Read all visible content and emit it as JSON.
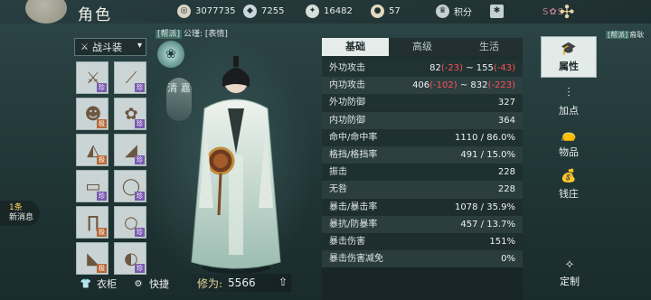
{
  "header": {
    "title": "角色",
    "currencies": [
      {
        "icon": "coin-icon",
        "value": "3077735"
      },
      {
        "icon": "ingot-icon",
        "value": "7255"
      },
      {
        "icon": "jade-icon",
        "value": "16482"
      },
      {
        "icon": "pouch-icon",
        "value": "57"
      }
    ],
    "points_icon": "badge-icon",
    "points_label": "积分"
  },
  "outfit": {
    "label": "战斗装"
  },
  "equipment": [
    {
      "icon": "sword-icon",
      "tag": "珍"
    },
    {
      "icon": "spear-icon",
      "tag": "珍"
    },
    {
      "icon": "hair-icon",
      "tag": "极"
    },
    {
      "icon": "flower-ornament-icon",
      "tag": "珍"
    },
    {
      "icon": "robe-icon",
      "tag": "极"
    },
    {
      "icon": "sleeve-icon",
      "tag": "珍"
    },
    {
      "icon": "belt-icon",
      "tag": "珍"
    },
    {
      "icon": "bracelet-icon",
      "tag": "珍"
    },
    {
      "icon": "pants-icon",
      "tag": "极"
    },
    {
      "icon": "ring-icon",
      "tag": "珍"
    },
    {
      "icon": "boots-icon",
      "tag": "极"
    },
    {
      "icon": "jade-pendant-icon",
      "tag": "珍"
    }
  ],
  "messages": {
    "count": "1条",
    "label": "新消息"
  },
  "bottom": {
    "wardrobe": "衣柜",
    "shortcut": "快捷",
    "power_label": "修为:",
    "power_value": "5566"
  },
  "guild": {
    "tag": "[帮派]",
    "text": "公瑾: [表情]"
  },
  "banner": {
    "text": "清 嘉"
  },
  "stats": {
    "tabs": [
      "基础",
      "高级",
      "生活"
    ],
    "active_tab": "基础",
    "rows": [
      {
        "k": "外功攻击",
        "a": "82",
        "an": "(-23)",
        "sep": " ~ ",
        "b": "155",
        "bn": "(-43)"
      },
      {
        "k": "内功攻击",
        "a": "406",
        "an": "(-102)",
        "sep": " ~ ",
        "b": "832",
        "bn": "(-223)"
      },
      {
        "k": "外功防御",
        "v": "327"
      },
      {
        "k": "内功防御",
        "v": "364"
      },
      {
        "k": "命中/命中率",
        "v": "1110 / 86.0%"
      },
      {
        "k": "格挡/格挡率",
        "v": "491 / 15.0%"
      },
      {
        "k": "振击",
        "v": "228"
      },
      {
        "k": "无咎",
        "v": "228"
      },
      {
        "k": "暴击/暴击率",
        "v": "1078 / 35.9%"
      },
      {
        "k": "暴抗/防暴率",
        "v": "457 / 13.7%"
      },
      {
        "k": "暴击伤害",
        "v": "151%"
      },
      {
        "k": "暴击伤害减免",
        "v": "0%"
      }
    ]
  },
  "menu": [
    {
      "label": "属性",
      "icon": "scholar-hat-icon",
      "active": true
    },
    {
      "label": "加点",
      "icon": "sliders-icon",
      "active": false
    },
    {
      "label": "物品",
      "icon": "bag-icon",
      "active": false
    },
    {
      "label": "钱庄",
      "icon": "money-bag-icon",
      "active": false
    }
  ],
  "customize": {
    "label": "定制"
  },
  "notif": {
    "tag": "[帮派]",
    "text": "裔耿"
  },
  "colors": {
    "accent": "#e3ebe9",
    "negative": "#ff5252",
    "zhen": "#7b5bb0",
    "ji": "#b76a38"
  }
}
